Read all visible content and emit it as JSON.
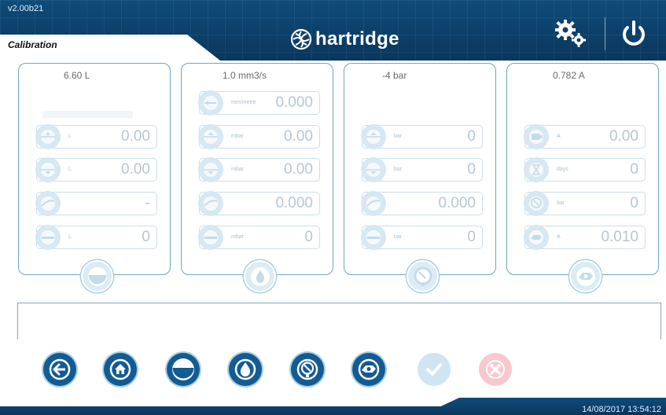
{
  "header": {
    "version": "v2.00b21",
    "screen_title": "Calibration",
    "logo_text": "hartridge"
  },
  "panels": [
    {
      "title": "6.60 L",
      "rows": [
        {
          "unit": "L",
          "value": "0.00",
          "icon": "fill-up-icon"
        },
        {
          "unit": "L",
          "value": "0.00",
          "icon": "fill-down-icon"
        },
        {
          "unit": "",
          "value": "-",
          "icon": "tank-icon"
        },
        {
          "unit": "L",
          "value": "0",
          "icon": "level-icon"
        }
      ],
      "badge_icon": "tank-level-icon"
    },
    {
      "title": "1.0 mm3/s",
      "rows": [
        {
          "unit": "mm/metre",
          "value": "0.000",
          "icon": "flow-icon"
        },
        {
          "unit": "mbar",
          "value": "0.00",
          "icon": "pressure-up-icon"
        },
        {
          "unit": "mbar",
          "value": "0.00",
          "icon": "pressure-down-icon"
        },
        {
          "unit": "",
          "value": "0.000",
          "icon": "gauge-icon"
        },
        {
          "unit": "mbar",
          "value": "0",
          "icon": "level-icon"
        }
      ],
      "badge_icon": "droplet-icon"
    },
    {
      "title": "-4 bar",
      "rows": [
        {
          "unit": "bar",
          "value": "0",
          "icon": "pressure-up-icon"
        },
        {
          "unit": "bar",
          "value": "0",
          "icon": "pressure-down-icon"
        },
        {
          "unit": "",
          "value": "0.000",
          "icon": "gauge-icon"
        },
        {
          "unit": "bar",
          "value": "0",
          "icon": "level-icon"
        }
      ],
      "badge_icon": "pressure-gauge-icon"
    },
    {
      "title": "0.782 A",
      "rows": [
        {
          "unit": "A",
          "value": "0.00",
          "icon": "motor-icon"
        },
        {
          "unit": "days",
          "value": "0",
          "icon": "hourglass-icon"
        },
        {
          "unit": "bar",
          "value": "0",
          "icon": "pressure-gauge-icon"
        },
        {
          "unit": "A",
          "value": "0.010",
          "icon": "pump-icon"
        }
      ],
      "badge_icon": "pump-motor-icon"
    }
  ],
  "toolbar": [
    {
      "name": "back-button",
      "icon": "arrow-left-icon",
      "style": "dark"
    },
    {
      "name": "home-button",
      "icon": "home-icon",
      "style": "dark"
    },
    {
      "name": "tank-button",
      "icon": "tank-level-icon",
      "style": "dark"
    },
    {
      "name": "fluid-button",
      "icon": "droplet-icon",
      "style": "dark"
    },
    {
      "name": "pressure-button",
      "icon": "pressure-gauge-icon",
      "style": "dark"
    },
    {
      "name": "pump-button",
      "icon": "pump-motor-icon",
      "style": "dark"
    },
    {
      "name": "confirm-button",
      "icon": "check-icon",
      "style": "disabled"
    },
    {
      "name": "cancel-button",
      "icon": "close-icon",
      "style": "disabled-red"
    }
  ],
  "footer": {
    "timestamp": "14/08/2017 13:54:12"
  },
  "colors": {
    "brand_dark": "#0c3f69",
    "accent": "#135b93",
    "panel_border": "#6fa6c3",
    "disabled": "#cfe5f1",
    "cancel_disabled": "#f7c9cf"
  }
}
